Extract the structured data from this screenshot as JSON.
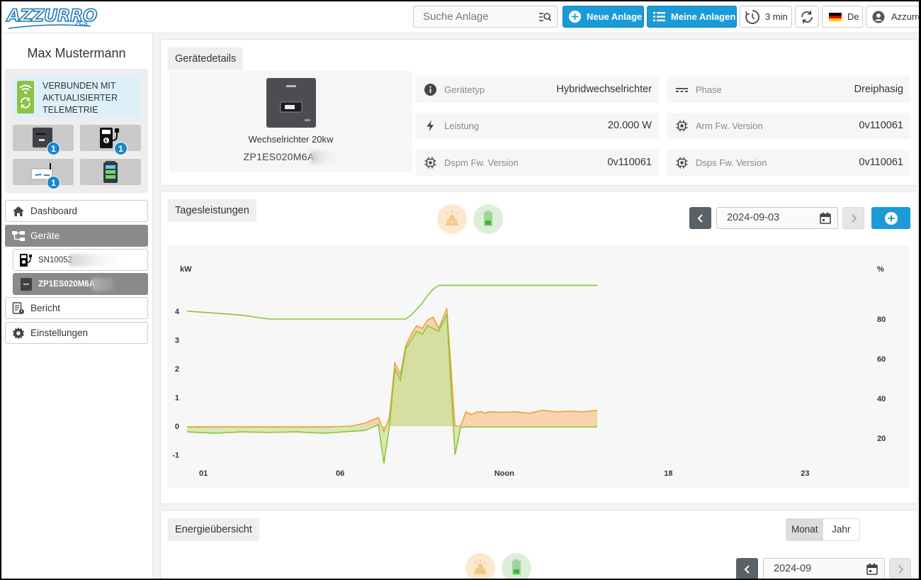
{
  "header": {
    "logo_text": "AZZURRO",
    "logo_sub": "ZCS",
    "search_placeholder": "Suche Anlage",
    "new_plant": "Neue Anlage",
    "my_plants": "Meine Anlagen",
    "refresh_interval": "3 min",
    "language": "De",
    "user_short": "Azzurro"
  },
  "sidebar": {
    "user_name": "Max Mustermann",
    "status_text": "VERBUNDEN MIT AKTUALISIERTER TELEMETRIE",
    "tiles": [
      {
        "icon": "inverter-icon",
        "badge": "1"
      },
      {
        "icon": "ev-charger-icon",
        "badge": "1"
      },
      {
        "icon": "datalogger-icon",
        "badge": "1"
      },
      {
        "icon": "battery-icon"
      }
    ],
    "nav": {
      "dashboard": "Dashboard",
      "devices": "Geräte",
      "device_1": "SN10052",
      "device_2": "ZP1ES020M6A",
      "report": "Bericht",
      "settings": "Einstellungen"
    }
  },
  "details": {
    "title": "Gerätedetails",
    "device_name": "Wechselrichter 20kw",
    "device_sn": "ZP1ES020M6A",
    "props": [
      {
        "label": "Gerätetyp",
        "value": "Hybridwechselrichter",
        "icon": "info-icon"
      },
      {
        "label": "Phase",
        "value": "Dreiphasig",
        "icon": "phase-icon"
      },
      {
        "label": "Leistung",
        "value": "20.000 W",
        "icon": "bolt-icon"
      },
      {
        "label": "Arm Fw. Version",
        "value": "0v110061",
        "icon": "chip-icon"
      },
      {
        "label": "Dspm Fw. Version",
        "value": "0v110061",
        "icon": "chip-icon"
      },
      {
        "label": "Dsps Fw. Version",
        "value": "0v110061",
        "icon": "chip-icon"
      }
    ]
  },
  "daily": {
    "title": "Tagesleistungen",
    "date": "2024-09-03"
  },
  "energy": {
    "title": "Energieübersicht",
    "toggle_month": "Monat",
    "toggle_year": "Jahr",
    "date": "2024-09"
  },
  "colors": {
    "accent": "#1a9bd7",
    "production": "#f0a030",
    "battery": "#8cc43c"
  },
  "chart_data": {
    "type": "area",
    "ylabel_left": "kW",
    "ylabel_right": "%",
    "left_ticks": [
      "4",
      "3",
      "2",
      "1",
      "0",
      "-1"
    ],
    "right_ticks": [
      "80",
      "60",
      "40",
      "20"
    ],
    "x_ticks": [
      "01",
      "06",
      "Noon",
      "18",
      "23"
    ],
    "x_hours": [
      0,
      1,
      2,
      3,
      4,
      5,
      6,
      6.5,
      7,
      7.2,
      7.4,
      7.6,
      7.8,
      8,
      8.2,
      8.4,
      8.6,
      8.8,
      9,
      9.2,
      9.5,
      9.8,
      10,
      10.2,
      10.4,
      10.6,
      10.8,
      10.9,
      11,
      11.5,
      12,
      12.5,
      13,
      13.5,
      14,
      14.5,
      15
    ],
    "series": [
      {
        "unit": "kW",
        "color": "#f0a030",
        "values": [
          -0.03,
          -0.03,
          -0.03,
          -0.03,
          -0.03,
          -0.03,
          0.0,
          0.1,
          0.3,
          -0.2,
          0.3,
          2.2,
          1.8,
          2.8,
          3.2,
          3.5,
          3.4,
          3.7,
          3.8,
          3.4,
          4.1,
          0.0,
          0.0,
          0.5,
          0.4,
          0.5,
          0.5,
          0.45,
          0.5,
          0.48,
          0.5,
          0.45,
          0.55,
          0.5,
          0.52,
          0.5,
          0.55
        ]
      },
      {
        "unit": "kW",
        "color": "#8cc43c",
        "values": [
          -0.2,
          -0.25,
          -0.2,
          -0.22,
          -0.2,
          -0.25,
          -0.18,
          -0.15,
          0.05,
          -1.3,
          0.0,
          2.0,
          1.6,
          2.7,
          3.0,
          3.3,
          3.2,
          3.5,
          3.4,
          3.3,
          3.9,
          -1.0,
          -0.05,
          -0.03,
          -0.03,
          -0.03,
          -0.03,
          -0.03,
          -0.03,
          -0.03,
          -0.03,
          -0.03,
          -0.03,
          -0.03,
          -0.03,
          -0.03,
          -0.03
        ]
      },
      {
        "unit": "%",
        "color": "#8cc43c",
        "values": [
          84,
          83,
          82,
          80,
          80,
          80,
          80,
          80,
          80,
          80,
          80,
          80,
          80,
          80,
          82,
          85,
          88,
          92,
          95,
          97,
          97,
          97,
          97,
          97,
          97,
          97,
          97,
          97,
          97,
          97,
          97,
          97,
          97,
          97,
          97,
          97,
          97
        ]
      }
    ]
  }
}
